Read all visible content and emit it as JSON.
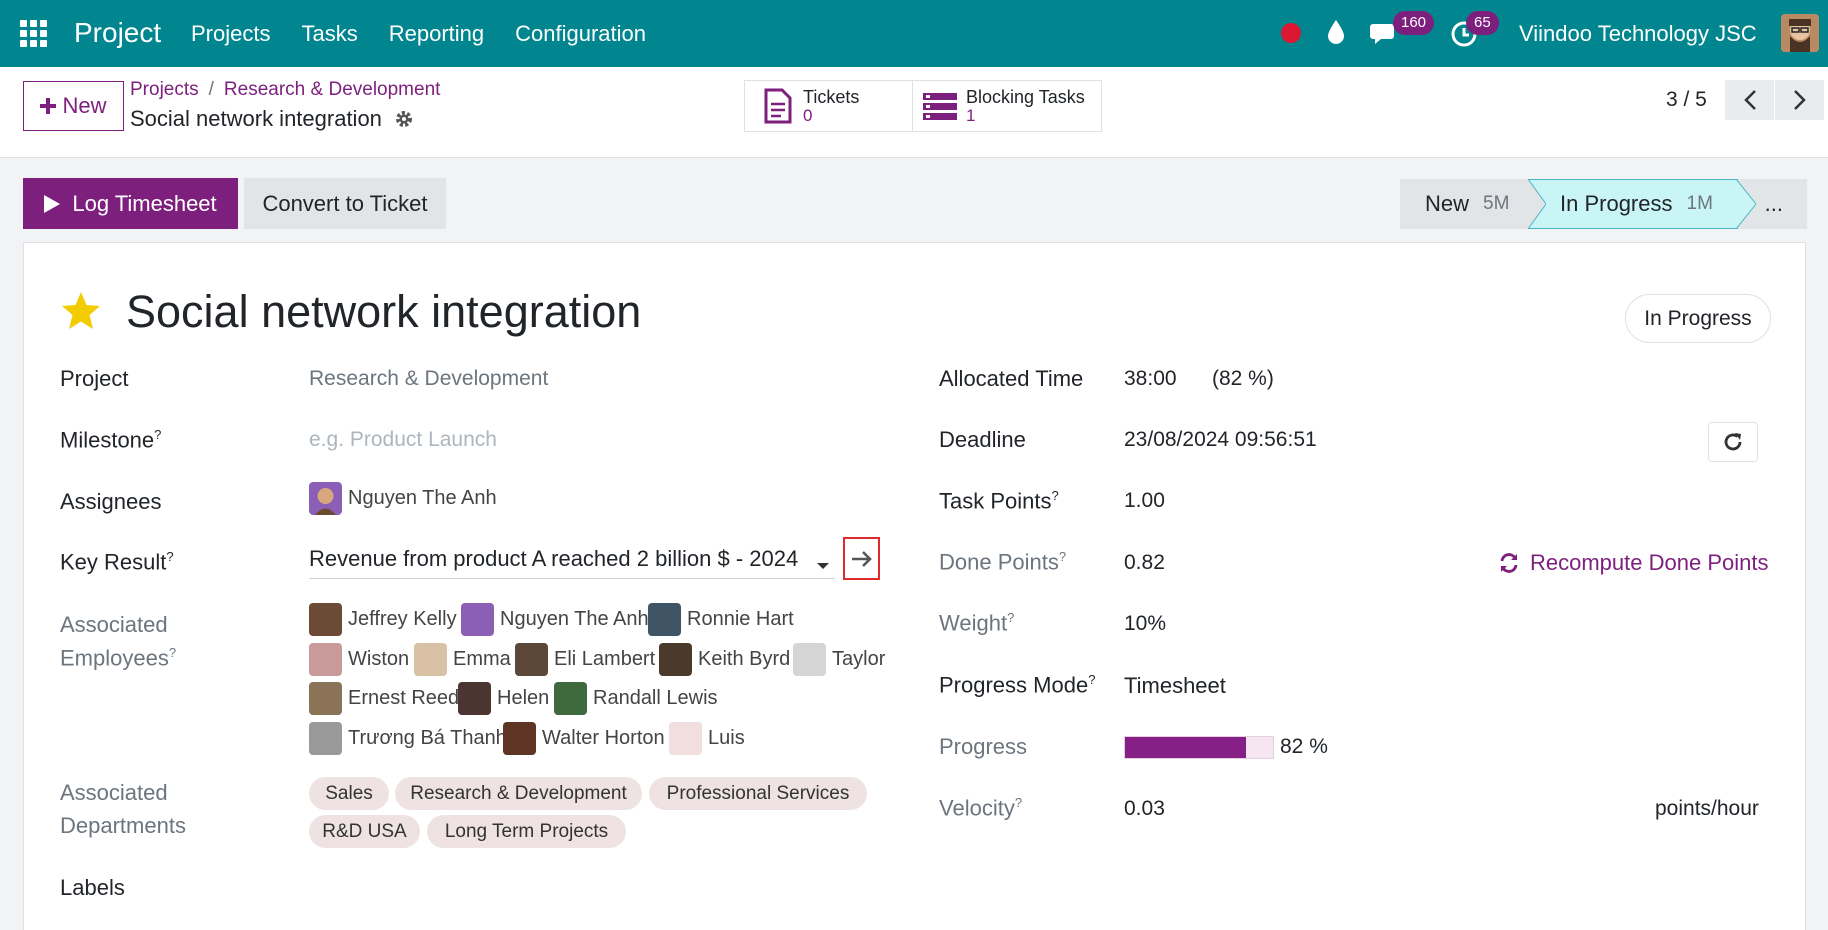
{
  "topbar": {
    "brand": "Project",
    "menu": [
      "Projects",
      "Tasks",
      "Reporting",
      "Configuration"
    ],
    "chat_count": "160",
    "activity_count": "65",
    "company": "Viindoo Technology JSC"
  },
  "control_panel": {
    "new_label": "New",
    "breadcrumb": [
      "Projects",
      "Research & Development"
    ],
    "current": "Social network integration",
    "smart_buttons": [
      {
        "label": "Tickets",
        "value": "0",
        "icon": "document-icon"
      },
      {
        "label": "Blocking Tasks",
        "value": "1",
        "icon": "tasks-icon"
      }
    ],
    "pager": "3 / 5"
  },
  "actions": {
    "log_timesheet": "Log Timesheet",
    "convert_ticket": "Convert to Ticket"
  },
  "stages": [
    {
      "name": "New",
      "duration": "5M"
    },
    {
      "name": "In Progress",
      "duration": "1M"
    },
    {
      "name": "..."
    }
  ],
  "task": {
    "title": "Social network integration",
    "state": "In Progress",
    "starred": true
  },
  "left_fields": {
    "project_label": "Project",
    "project_value": "Research & Development",
    "milestone_label": "Milestone",
    "milestone_placeholder": "e.g. Product Launch",
    "assignees_label": "Assignees",
    "assignee": "Nguyen The Anh",
    "key_result_label": "Key Result",
    "key_result_value": "Revenue from product A reached 2 billion $ - 2024",
    "employees_label_1": "Associated",
    "employees_label_2": "Employees",
    "employees": [
      "Jeffrey Kelly",
      "Nguyen The Anh",
      "Ronnie Hart",
      "Wiston",
      "Emma",
      "Eli Lambert",
      "Keith Byrd",
      "Taylor",
      "Ernest Reed",
      "Helen",
      "Randall Lewis",
      "Trương Bá Thanh",
      "Walter Horton",
      "Luis"
    ],
    "departments_label_1": "Associated",
    "departments_label_2": "Departments",
    "departments": [
      "Sales",
      "Research & Development",
      "Professional Services",
      "R&D USA",
      "Long Term Projects"
    ],
    "labels_label": "Labels"
  },
  "right_fields": {
    "allocated_label": "Allocated Time",
    "allocated_value": "38:00",
    "allocated_pct": "(82 %)",
    "deadline_label": "Deadline",
    "deadline_value": "23/08/2024 09:56:51",
    "task_points_label": "Task Points",
    "task_points_value": "1.00",
    "done_points_label": "Done Points",
    "done_points_value": "0.82",
    "recompute_label": "Recompute Done Points",
    "weight_label": "Weight",
    "weight_value": "10%",
    "progress_mode_label": "Progress Mode",
    "progress_mode_value": "Timesheet",
    "progress_label": "Progress",
    "progress_value": 0.82,
    "progress_text": "82 %",
    "velocity_label": "Velocity",
    "velocity_value": "0.03",
    "velocity_unit": "points/hour"
  },
  "colors": {
    "topbar": "#01868f",
    "primary": "#7d1f7d",
    "progress": "#861f86"
  }
}
